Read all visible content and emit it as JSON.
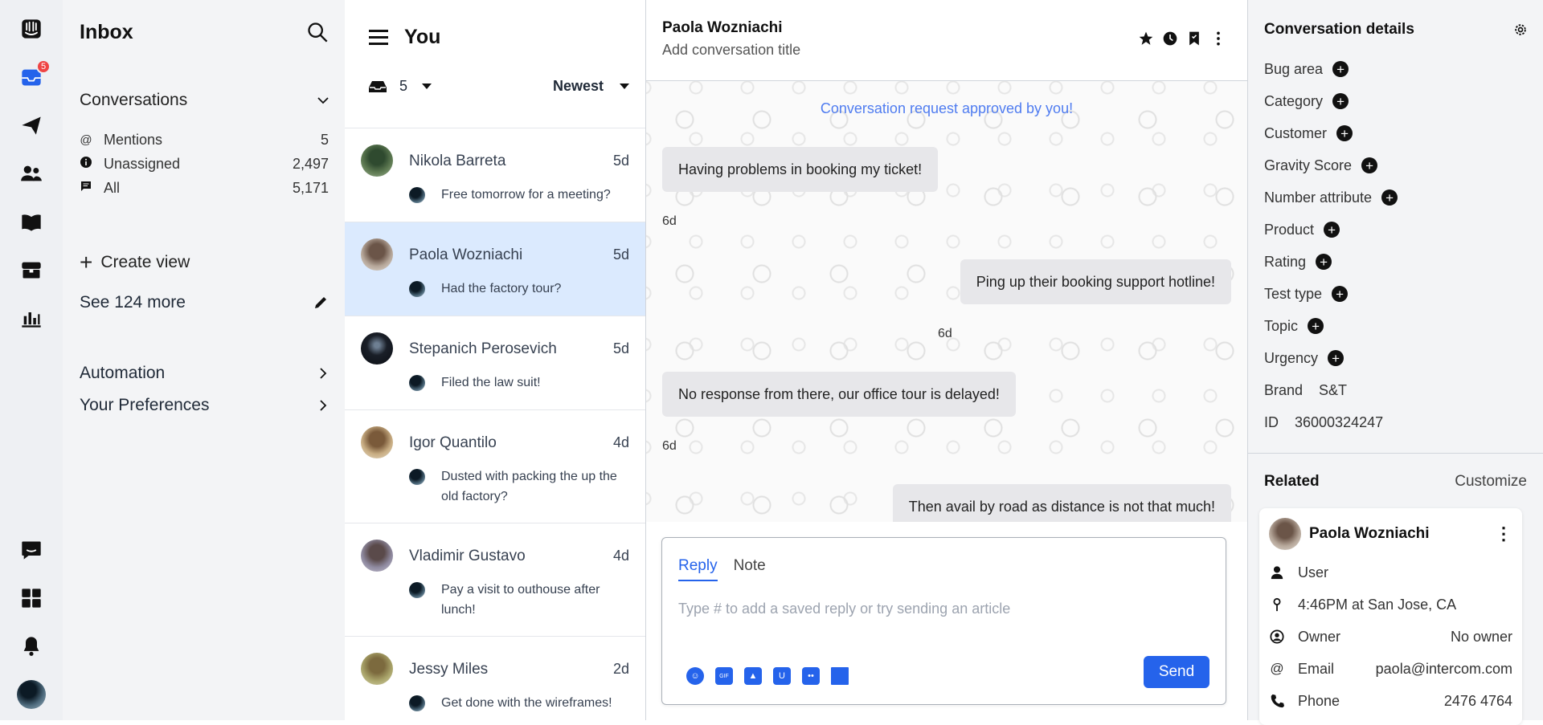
{
  "rail": {
    "badge_count": "5",
    "icons": [
      "intercom-logo-icon",
      "inbox-icon",
      "send-icon",
      "contacts-icon",
      "book-icon",
      "store-icon",
      "chart-icon",
      "chat-icon",
      "apps-icon",
      "bell-icon"
    ]
  },
  "sidebar": {
    "title": "Inbox",
    "conversations_label": "Conversations",
    "counts": [
      {
        "label": "Mentions",
        "value": "5",
        "icon": "@"
      },
      {
        "label": "Unassigned",
        "value": "2,497",
        "icon": "i"
      },
      {
        "label": "All",
        "value": "5,171",
        "icon": "chat"
      }
    ],
    "create_view": "Create view",
    "see_more": "See 124 more",
    "menu": [
      {
        "label": "Automation"
      },
      {
        "label": "Your Preferences"
      }
    ]
  },
  "list": {
    "title": "You",
    "open_count": "5",
    "sort": "Newest",
    "items": [
      {
        "name": "Nikola Barreta",
        "time": "5d",
        "preview": "Free tomorrow for a meeting?"
      },
      {
        "name": "Paola Wozniachi",
        "time": "5d",
        "preview": "Had the factory tour?"
      },
      {
        "name": "Stepanich Perosevich",
        "time": "5d",
        "preview": "Filed the law suit!"
      },
      {
        "name": "Igor Quantilo",
        "time": "4d",
        "preview": "Dusted with packing the up the old factory?"
      },
      {
        "name": "Vladimir Gustavo",
        "time": "4d",
        "preview": "Pay a visit to outhouse after lunch!"
      },
      {
        "name": "Jessy Miles",
        "time": "2d",
        "preview": "Get done with the wireframes!"
      }
    ]
  },
  "conversation": {
    "contact_name": "Paola Wozniachi",
    "title_placeholder": "Add conversation title",
    "notice": "Conversation request approved by you!",
    "messages": [
      {
        "text": "Having problems in booking my ticket!",
        "time": "6d"
      },
      {
        "text": "Ping up their booking support hotline!",
        "time": "6d"
      },
      {
        "text": "No response from there, our office tour is delayed!",
        "time": "6d"
      },
      {
        "text": "Then avail by road as distance is not that much!",
        "time": ""
      }
    ]
  },
  "composer": {
    "tab_reply": "Reply",
    "tab_note": "Note",
    "placeholder": "Type # to add a saved reply or try sending an article",
    "send": "Send",
    "gif": "GIF"
  },
  "details": {
    "title": "Conversation details",
    "attributes": [
      {
        "label": "Bug area"
      },
      {
        "label": "Category"
      },
      {
        "label": "Customer"
      },
      {
        "label": "Gravity Score"
      },
      {
        "label": "Number attribute"
      },
      {
        "label": "Product"
      },
      {
        "label": "Rating"
      },
      {
        "label": "Test type"
      },
      {
        "label": "Topic"
      },
      {
        "label": "Urgency"
      }
    ],
    "brand_label": "Brand",
    "brand_value": "S&T",
    "id_label": "ID",
    "id_value": "36000324247",
    "related": "Related",
    "customize": "Customize",
    "card": {
      "name": "Paola Wozniachi",
      "role": "User",
      "location": "4:46PM at San Jose, CA",
      "owner_label": "Owner",
      "owner_value": "No owner",
      "email_label": "Email",
      "email_value": "paola@intercom.com",
      "phone_label": "Phone",
      "phone_value": "2476 4764"
    }
  },
  "colors": {
    "accent": "#2563eb",
    "selected": "#dbeafe",
    "badge": "#ef4444"
  }
}
